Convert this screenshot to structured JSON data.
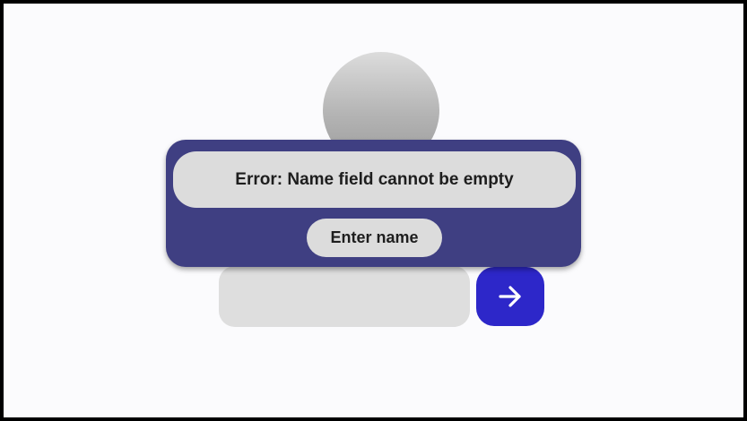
{
  "profile": {
    "avatar_icon": "user-avatar-placeholder"
  },
  "form": {
    "name_input": {
      "value": "",
      "placeholder": ""
    },
    "submit_icon": "arrow-right-icon"
  },
  "error_dialog": {
    "message": "Error: Name field cannot be empty",
    "action_label": "Enter name"
  },
  "colors": {
    "page_background": "#fbfbfd",
    "frame_border": "#000000",
    "dialog_background": "#3f3f82",
    "pill_background": "#dcdcdc",
    "input_background": "#dedede",
    "accent": "#2d27c9",
    "text": "#1e1e1e"
  }
}
